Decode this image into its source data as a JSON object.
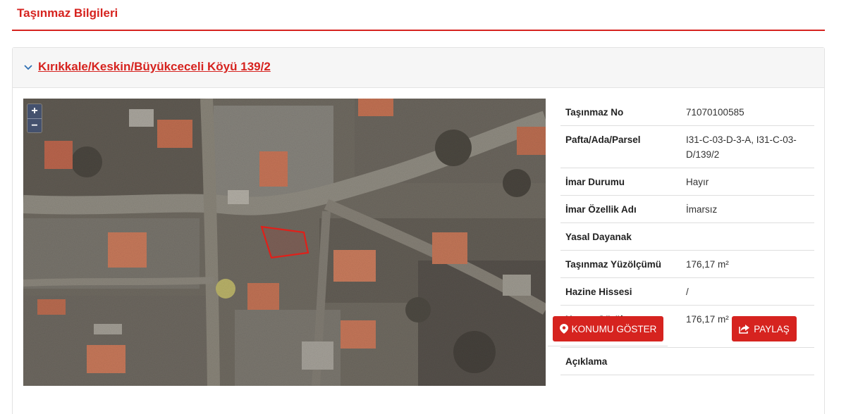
{
  "page": {
    "title": "Taşınmaz Bilgileri",
    "accent_color": "#d6231f"
  },
  "panel": {
    "link_text": "Kırıkkale/Keskin/Büyükceceli Köyü 139/2",
    "toggle_icon": "chevron-down-icon"
  },
  "map": {
    "zoom_in_label": "+",
    "zoom_out_label": "−",
    "parcel_outline_color": "#e0201a"
  },
  "details": [
    {
      "label": "Taşınmaz No",
      "value": "71070100585"
    },
    {
      "label": "Pafta/Ada/Parsel",
      "value": "I31-C-03-D-3-A, I31-C-03-D/139/2"
    },
    {
      "label": "İmar Durumu",
      "value": "Hayır"
    },
    {
      "label": "İmar Özellik Adı",
      "value": "İmarsız"
    },
    {
      "label": "Yasal Dayanak",
      "value": ""
    },
    {
      "label": "Taşınmaz Yüzölçümü",
      "value": "176,17 m²"
    },
    {
      "label": "Hazine Hissesi",
      "value": "/"
    },
    {
      "label": "Uygun Görülen Yüzölçümü",
      "value": "176,17 m²"
    },
    {
      "label": "Açıklama",
      "value": ""
    }
  ],
  "actions": {
    "locate_label": "KONUMU GÖSTER",
    "locate_icon": "map-marker-icon",
    "share_label": "PAYLAŞ",
    "share_icon": "share-icon"
  }
}
